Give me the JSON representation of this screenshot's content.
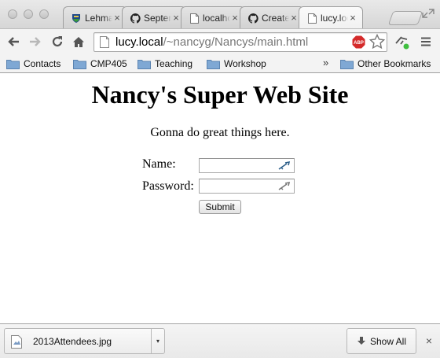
{
  "tabs": [
    {
      "title": "Lehman",
      "icon": "lehman-shield-icon",
      "active": false
    },
    {
      "title": "September",
      "icon": "github-icon",
      "active": false
    },
    {
      "title": "localhost",
      "icon": "page-icon",
      "active": false
    },
    {
      "title": "Create",
      "icon": "github-icon",
      "active": false
    },
    {
      "title": "lucy.local",
      "icon": "page-icon",
      "active": true
    }
  ],
  "toolbar": {
    "url_host": "lucy.local",
    "url_path": "/~nancyg/Nancys/main.html",
    "abp_label": "ABP"
  },
  "bookmarks": {
    "items": [
      "Contacts",
      "CMP405",
      "Teaching",
      "Workshop"
    ],
    "overflow": "»",
    "other": "Other Bookmarks"
  },
  "page": {
    "heading": "Nancy's Super Web Site",
    "tagline": "Gonna do great things here.",
    "name_label": "Name:",
    "password_label": "Password:",
    "name_value": "",
    "password_value": "",
    "submit_label": "Submit"
  },
  "downloads": {
    "file_name": "2013Attendees.jpg",
    "menu_arrow": "▾",
    "show_all": "Show All",
    "close": "×"
  },
  "colors": {
    "abp_red": "#d42a2a",
    "ext_green": "#3fbf3f",
    "folder_blue": "#7fa8d4"
  }
}
